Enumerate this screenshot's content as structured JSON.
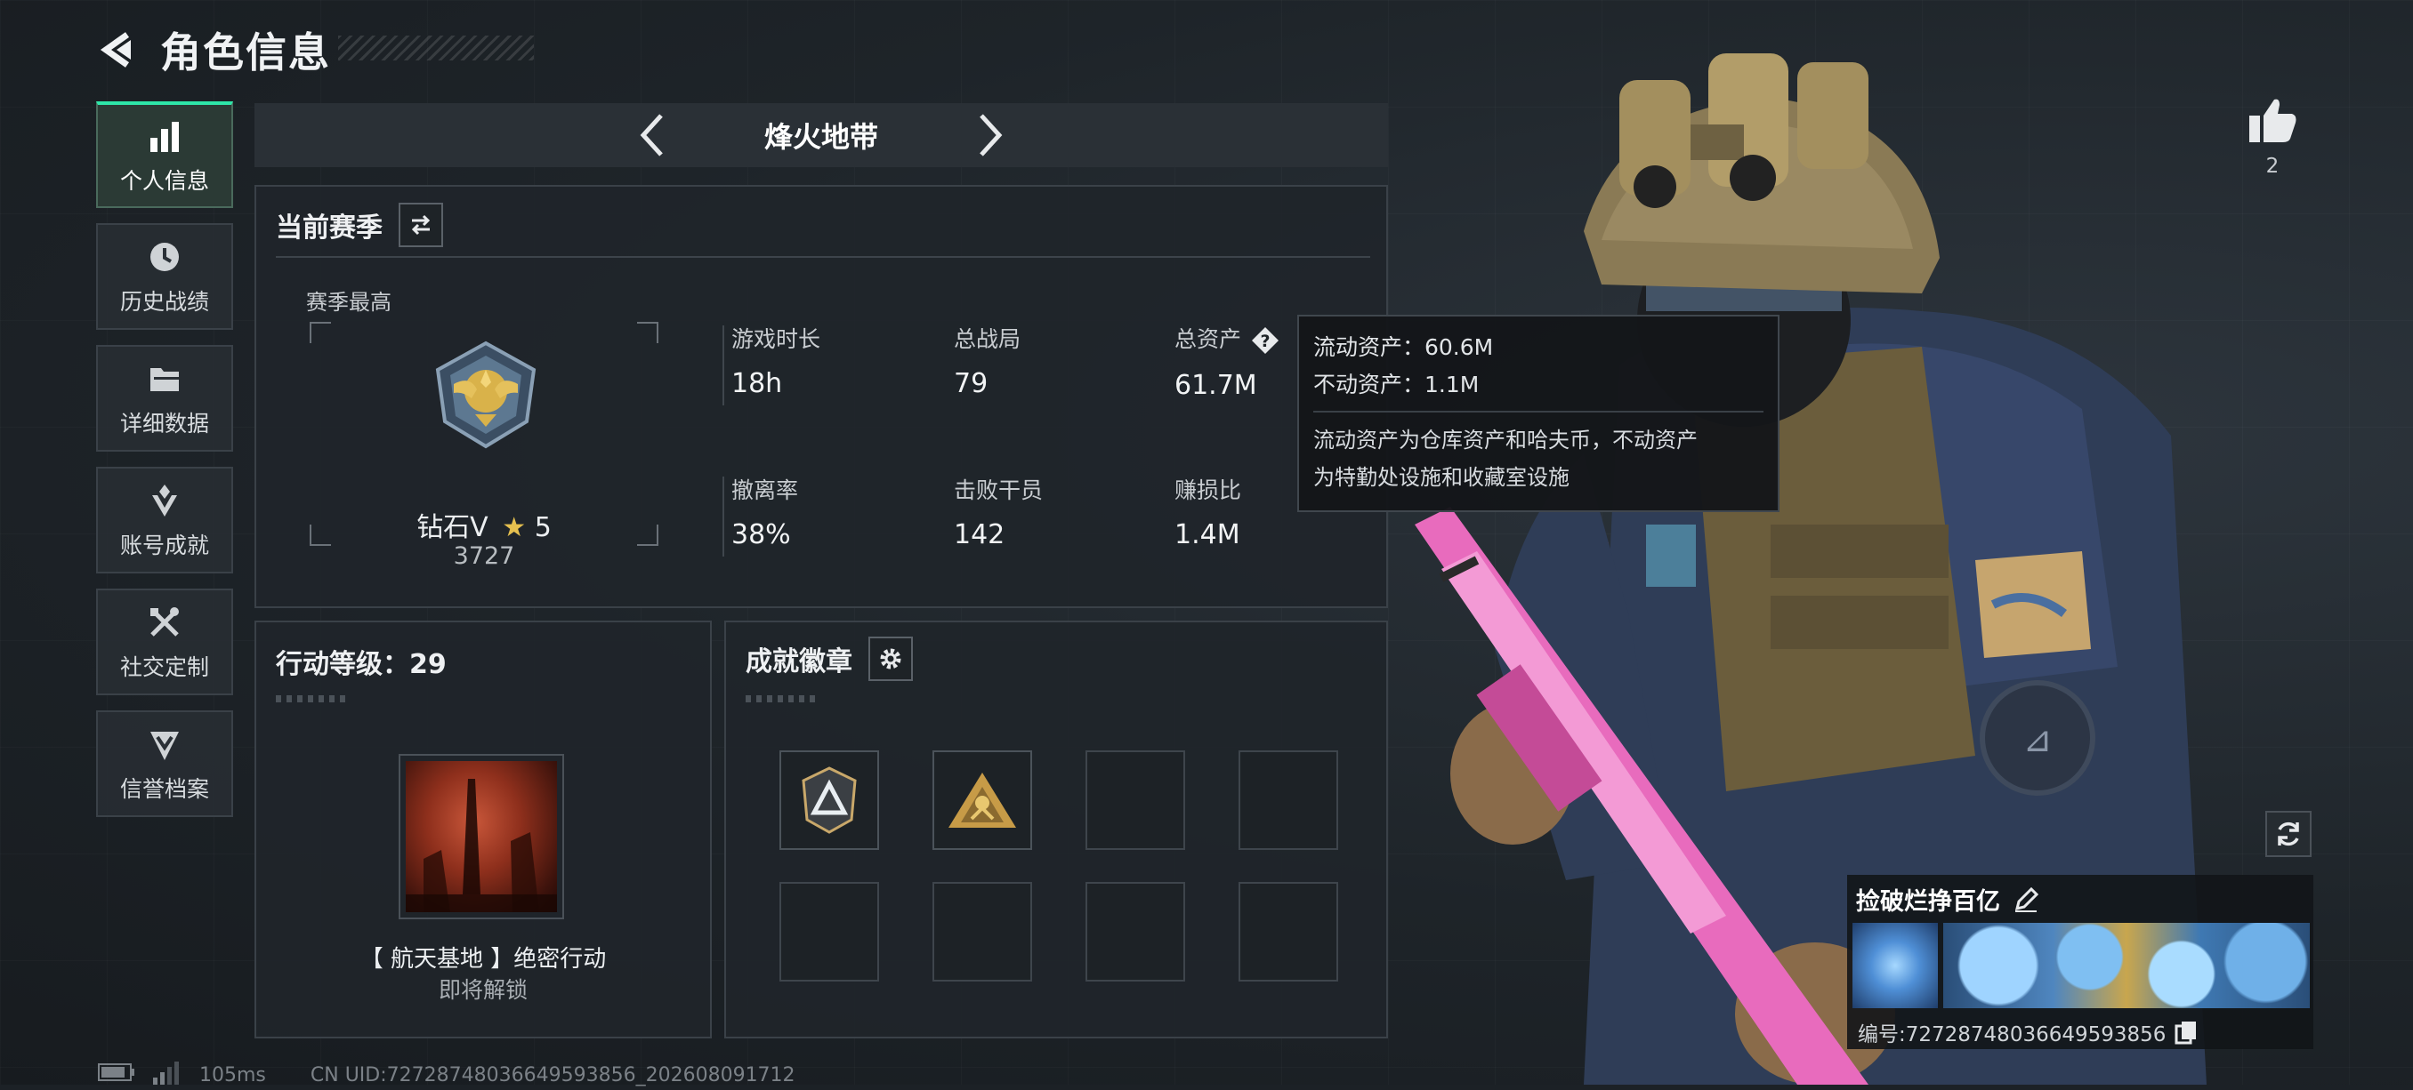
{
  "header": {
    "title": "角色信息"
  },
  "sidebar": {
    "items": [
      {
        "label": "个人信息",
        "icon": "bar-chart-icon",
        "active": true
      },
      {
        "label": "历史战绩",
        "icon": "history-icon"
      },
      {
        "label": "详细数据",
        "icon": "folder-icon"
      },
      {
        "label": "账号成就",
        "icon": "achievement-icon"
      },
      {
        "label": "社交定制",
        "icon": "tools-icon"
      },
      {
        "label": "信誉档案",
        "icon": "credit-icon"
      }
    ]
  },
  "mode": {
    "title": "烽火地带"
  },
  "season": {
    "title": "当前赛季",
    "best_label": "赛季最高",
    "rank_name": "钻石V",
    "rank_stars": "5",
    "rank_score": "3727",
    "stats": [
      {
        "label": "游戏时长",
        "value": "18h"
      },
      {
        "label": "总战局",
        "value": "79"
      },
      {
        "label": "总资产",
        "value": "61.7M"
      },
      {
        "label": "撤离率",
        "value": "38%"
      },
      {
        "label": "击败干员",
        "value": "142"
      },
      {
        "label": "赚损比",
        "value": "1.4M"
      }
    ]
  },
  "tooltip": {
    "liquid": "流动资产：60.6M",
    "fixed": "不动资产：1.1M",
    "desc_line1": "流动资产为仓库资产和哈夫币，不动资产",
    "desc_line2": "为特勤处设施和收藏室设施"
  },
  "level": {
    "title": "行动等级：29",
    "mission_name": "【 航天基地 】绝密行动",
    "mission_status": "即将解锁"
  },
  "badges": {
    "title": "成就徽章"
  },
  "profile": {
    "like_count": "2",
    "nickname": "捡破烂挣百亿",
    "id": "编号:72728748036649593856"
  },
  "footer": {
    "ping": "105ms",
    "uid": "CN UID:72728748036649593856_202608091712"
  },
  "colors": {
    "accent": "#2ee6a8",
    "gold": "#d9b24a"
  }
}
